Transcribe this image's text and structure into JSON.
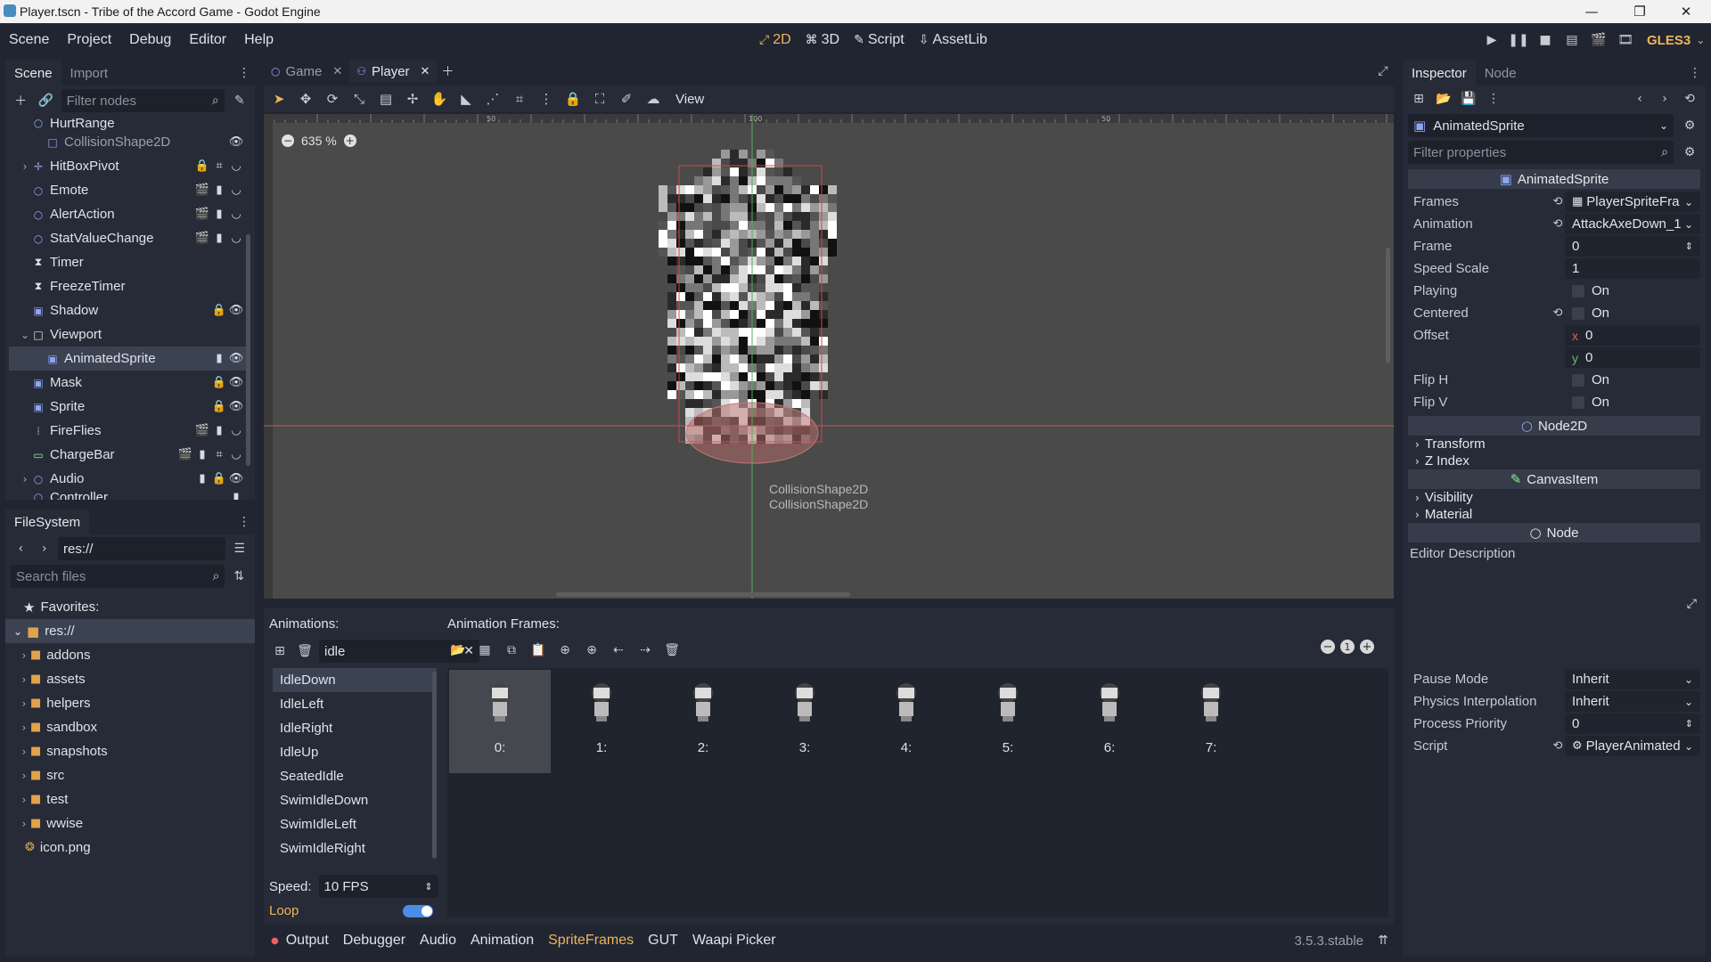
{
  "window": {
    "title": "Player.tscn - Tribe of the Accord Game - Godot Engine",
    "min": "—",
    "max": "❐",
    "close": "✕"
  },
  "menu": {
    "items": [
      "Scene",
      "Project",
      "Debug",
      "Editor",
      "Help"
    ]
  },
  "workspaces": {
    "items": [
      {
        "label": "2D",
        "icon": "⤢",
        "active": true
      },
      {
        "label": "3D",
        "icon": "⌘",
        "active": false
      },
      {
        "label": "Script",
        "icon": "✎",
        "active": false
      },
      {
        "label": "AssetLib",
        "icon": "⇩",
        "active": false
      }
    ]
  },
  "play": {
    "renderer": "GLES3"
  },
  "scene_dock": {
    "tabs": [
      "Scene",
      "Import"
    ],
    "filter_placeholder": "Filter nodes",
    "nodes": [
      {
        "name": "HurtRange",
        "indent": 1,
        "icon": "○",
        "icon_color": "#8da5f3",
        "arrow": "",
        "badges": [],
        "partial": true
      },
      {
        "name": "CollisionShape2D",
        "indent": 2,
        "icon": "□",
        "icon_color": "#8da5f3",
        "arrow": "",
        "badges": [
          "👁"
        ],
        "dim": true
      },
      {
        "name": "HitBoxPivot",
        "indent": 1,
        "icon": "✛",
        "icon_color": "#8da5f3",
        "arrow": "›",
        "badges": [
          "🔒",
          "⌗",
          "◡"
        ]
      },
      {
        "name": "Emote",
        "indent": 1,
        "icon": "○",
        "icon_color": "#8da5f3",
        "arrow": "",
        "badges": [
          "🎬",
          "▮",
          "◡"
        ]
      },
      {
        "name": "AlertAction",
        "indent": 1,
        "icon": "○",
        "icon_color": "#8da5f3",
        "arrow": "",
        "badges": [
          "🎬",
          "▮",
          "◡"
        ]
      },
      {
        "name": "StatValueChange",
        "indent": 1,
        "icon": "○",
        "icon_color": "#8da5f3",
        "arrow": "",
        "badges": [
          "🎬",
          "▮",
          "◡"
        ]
      },
      {
        "name": "Timer",
        "indent": 1,
        "icon": "⧗",
        "icon_color": "#dfe2e8",
        "arrow": "",
        "badges": []
      },
      {
        "name": "FreezeTimer",
        "indent": 1,
        "icon": "⧗",
        "icon_color": "#dfe2e8",
        "arrow": "",
        "badges": []
      },
      {
        "name": "Shadow",
        "indent": 1,
        "icon": "▣",
        "icon_color": "#8da5f3",
        "arrow": "",
        "badges": [
          "🔒",
          "👁"
        ]
      },
      {
        "name": "Viewport",
        "indent": 1,
        "icon": "□",
        "icon_color": "#dfe2e8",
        "arrow": "⌄",
        "badges": []
      },
      {
        "name": "AnimatedSprite",
        "indent": 2,
        "icon": "▣",
        "icon_color": "#8da5f3",
        "arrow": "",
        "badges": [
          "▮",
          "👁"
        ],
        "selected": true
      },
      {
        "name": "Mask",
        "indent": 1,
        "icon": "▣",
        "icon_color": "#8da5f3",
        "arrow": "",
        "badges": [
          "🔒",
          "👁"
        ]
      },
      {
        "name": "Sprite",
        "indent": 1,
        "icon": "▣",
        "icon_color": "#8da5f3",
        "arrow": "",
        "badges": [
          "🔒",
          "👁"
        ]
      },
      {
        "name": "FireFlies",
        "indent": 1,
        "icon": "⁞",
        "icon_color": "#8da5f3",
        "arrow": "",
        "badges": [
          "🎬",
          "▮",
          "◡"
        ]
      },
      {
        "name": "ChargeBar",
        "indent": 1,
        "icon": "▭",
        "icon_color": "#8eef97",
        "arrow": "",
        "badges": [
          "🎬",
          "▮",
          "⌗",
          "◡"
        ]
      },
      {
        "name": "Audio",
        "indent": 1,
        "icon": "○",
        "icon_color": "#8da5f3",
        "arrow": "›",
        "badges": [
          "▮",
          "🔒",
          "👁"
        ]
      },
      {
        "name": "Controller",
        "indent": 1,
        "icon": "○",
        "icon_color": "#8da5f3",
        "arrow": "",
        "badges": [
          "▮"
        ],
        "partial": true
      }
    ]
  },
  "filesystem": {
    "title": "FileSystem",
    "path": "res://",
    "search_placeholder": "Search files",
    "favorites": "Favorites:",
    "root": "res://",
    "items": [
      {
        "name": "addons",
        "type": "folder"
      },
      {
        "name": "assets",
        "type": "folder"
      },
      {
        "name": "helpers",
        "type": "folder"
      },
      {
        "name": "sandbox",
        "type": "folder"
      },
      {
        "name": "snapshots",
        "type": "folder"
      },
      {
        "name": "src",
        "type": "folder"
      },
      {
        "name": "test",
        "type": "folder"
      },
      {
        "name": "wwise",
        "type": "folder"
      },
      {
        "name": "icon.png",
        "type": "file"
      }
    ]
  },
  "scene_tabs": {
    "tabs": [
      {
        "label": "Game",
        "icon": "○",
        "active": false
      },
      {
        "label": "Player",
        "icon": "⚇",
        "active": true
      }
    ]
  },
  "toolbar": {
    "view_label": "View"
  },
  "canvas": {
    "zoom": "635 %",
    "ruler_labels": [
      "50",
      "100",
      "50",
      "100"
    ],
    "collision_labels": [
      "CollisionShape2D",
      "CollisionShape2D"
    ]
  },
  "animations": {
    "title": "Animations:",
    "filter_value": "idle",
    "items": [
      "IdleDown",
      "IdleLeft",
      "IdleRight",
      "IdleUp",
      "SeatedIdle",
      "SwimIdleDown",
      "SwimIdleLeft",
      "SwimIdleRight"
    ],
    "selected": 0,
    "speed_label": "Speed:",
    "speed_value": "10 FPS",
    "loop_label": "Loop",
    "loop_on": true
  },
  "frames": {
    "title": "Animation Frames:",
    "items": [
      "0:",
      "1:",
      "2:",
      "3:",
      "4:",
      "5:",
      "6:",
      "7:"
    ],
    "selected": 0
  },
  "bottom_tabs": {
    "items": [
      "Output",
      "Debugger",
      "Audio",
      "Animation",
      "SpriteFrames",
      "GUT",
      "Waapi Picker"
    ],
    "active": "SpriteFrames",
    "version": "3.5.3.stable"
  },
  "inspector": {
    "tabs": [
      "Inspector",
      "Node"
    ],
    "object": "AnimatedSprite",
    "filter_placeholder": "Filter properties",
    "class_header": "AnimatedSprite",
    "props": [
      {
        "label": "Frames",
        "value": "PlayerSpriteFra",
        "revert": true,
        "kind": "resource"
      },
      {
        "label": "Animation",
        "value": "AttackAxeDown_1",
        "revert": true,
        "kind": "dropdown"
      },
      {
        "label": "Frame",
        "value": "0",
        "kind": "spin"
      },
      {
        "label": "Speed Scale",
        "value": "1",
        "kind": "text"
      },
      {
        "label": "Playing",
        "value": "On",
        "kind": "check"
      },
      {
        "label": "Centered",
        "value": "On",
        "revert": true,
        "kind": "check"
      },
      {
        "label": "Offset",
        "value": "0",
        "axis": "x",
        "kind": "vec"
      },
      {
        "label": "",
        "value": "0",
        "axis": "y",
        "kind": "vec"
      },
      {
        "label": "Flip H",
        "value": "On",
        "kind": "check"
      },
      {
        "label": "Flip V",
        "value": "On",
        "kind": "check"
      }
    ],
    "node2d_header": "Node2D",
    "node2d_sections": [
      "Transform",
      "Z Index"
    ],
    "canvasitem_header": "CanvasItem",
    "canvasitem_sections": [
      "Visibility",
      "Material"
    ],
    "node_header": "Node",
    "editor_description": "Editor Description",
    "node_props": [
      {
        "label": "Pause Mode",
        "value": "Inherit",
        "kind": "dropdown"
      },
      {
        "label": "Physics Interpolation",
        "value": "Inherit",
        "kind": "dropdown"
      },
      {
        "label": "Process Priority",
        "value": "0",
        "kind": "spin"
      },
      {
        "label": "Script",
        "value": "PlayerAnimated",
        "revert": true,
        "kind": "dropdown"
      }
    ]
  },
  "colors": {
    "accent": "#f0b55a",
    "blue": "#478cbf",
    "selection": "#3b4252",
    "panel": "#262b37",
    "bg": "#202531"
  }
}
